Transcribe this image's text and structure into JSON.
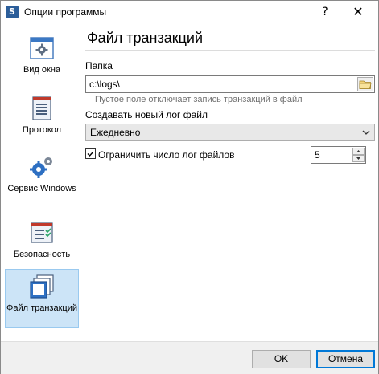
{
  "window": {
    "title": "Опции программы",
    "help_glyph": "?",
    "close_glyph": "✕",
    "app_icon_letter": "S"
  },
  "sidebar": {
    "items": [
      {
        "label": "Вид окна",
        "icon": "gear-window-icon"
      },
      {
        "label": "Протокол",
        "icon": "document-list-icon"
      },
      {
        "label": "Сервис Windows",
        "icon": "gears-icon"
      },
      {
        "label": "Безопасность",
        "icon": "checklist-icon"
      },
      {
        "label": "Файл транзакций",
        "icon": "stacked-pages-icon",
        "active": true
      }
    ]
  },
  "content": {
    "title": "Файл транзакций",
    "folder_label": "Папка",
    "folder_value": "c:\\logs\\",
    "folder_hint": "Пустое поле отключает запись транзакций в файл",
    "new_log_label": "Создавать новый лог файл",
    "new_log_value": "Ежедневно",
    "limit_label": "Ограничить число лог файлов",
    "limit_checked": true,
    "limit_value": "5"
  },
  "footer": {
    "ok_label": "OK",
    "cancel_label": "Отмена"
  },
  "colors": {
    "accent": "#0078d7",
    "active_nav_bg": "#cce4f7"
  }
}
